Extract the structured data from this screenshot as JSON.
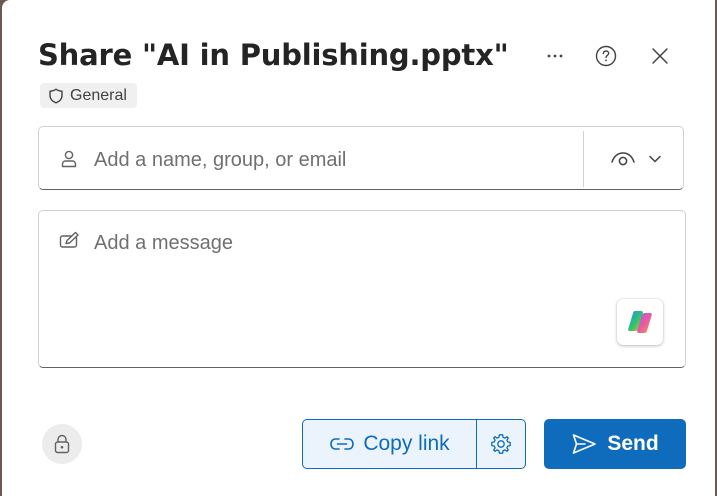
{
  "dialog": {
    "title": "Share \"AI in Publishing.pptx\"",
    "sensitivity_label": "General",
    "header_icons": [
      "more-icon",
      "help-icon",
      "close-icon"
    ]
  },
  "recipients": {
    "value": "",
    "placeholder": "Add a name, group, or email",
    "permission_icon": "eye-icon"
  },
  "message": {
    "value": "",
    "placeholder": "Add a message"
  },
  "footer": {
    "copy_link_label": "Copy link",
    "send_label": "Send"
  },
  "colors": {
    "accent": "#0f6cbd",
    "accent_light": "#ebf3fc"
  }
}
